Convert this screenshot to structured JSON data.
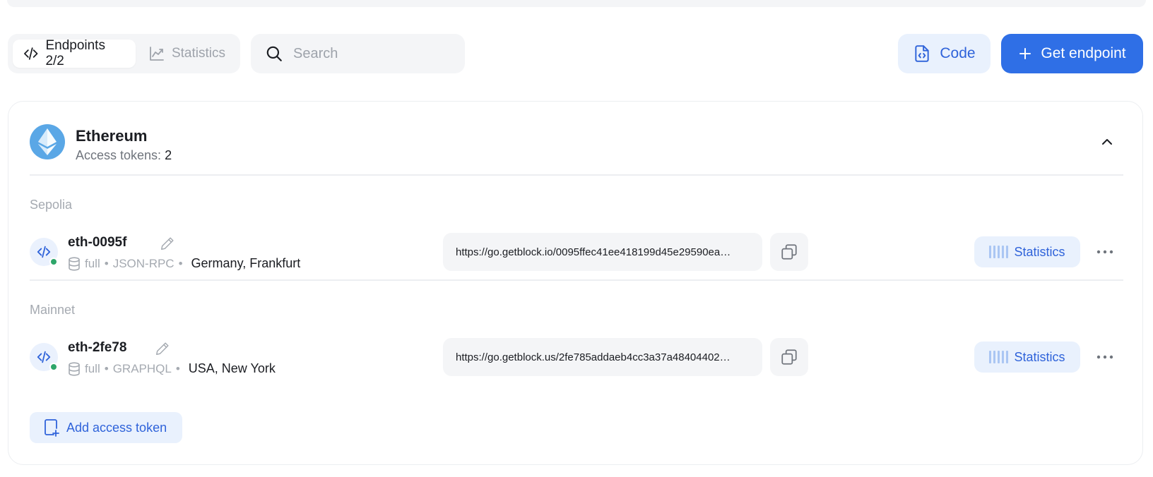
{
  "toolbar": {
    "tabs": [
      {
        "label": "Endpoints 2/2",
        "active": true,
        "icon": "code-icon"
      },
      {
        "label": "Statistics",
        "active": false,
        "icon": "chart-line-icon"
      }
    ],
    "search": {
      "placeholder": "Search",
      "value": ""
    },
    "code_button": "Code",
    "get_endpoint_button": "Get endpoint"
  },
  "chain": {
    "name": "Ethereum",
    "tokens_label": "Access tokens:",
    "tokens_count": "2",
    "icon": "ethereum-icon"
  },
  "networks": [
    {
      "label": "Sepolia",
      "endpoint": {
        "name": "eth-0095f",
        "mode": "full",
        "sep1": "•",
        "protocol": "JSON-RPC",
        "sep2": "•",
        "region": "Germany, Frankfurt",
        "url": "https://go.getblock.io/0095ffec41ee418199d45e29590ea…",
        "statistics_label": "Statistics",
        "status": "online"
      }
    },
    {
      "label": "Mainnet",
      "endpoint": {
        "name": "eth-2fe78",
        "mode": "full",
        "sep1": "•",
        "protocol": "GRAPHQL",
        "sep2": "•",
        "region": "USA, New York",
        "url": "https://go.getblock.us/2fe785addaeb4cc3a37a48404402…",
        "statistics_label": "Statistics",
        "status": "online"
      }
    }
  ],
  "add_token_label": "Add access token",
  "colors": {
    "accent": "#2f6fe6",
    "accent_soft": "#e9f1fd",
    "surface": "#f4f5f7",
    "status_online": "#2ea66a",
    "muted_text": "#a5aab1"
  }
}
